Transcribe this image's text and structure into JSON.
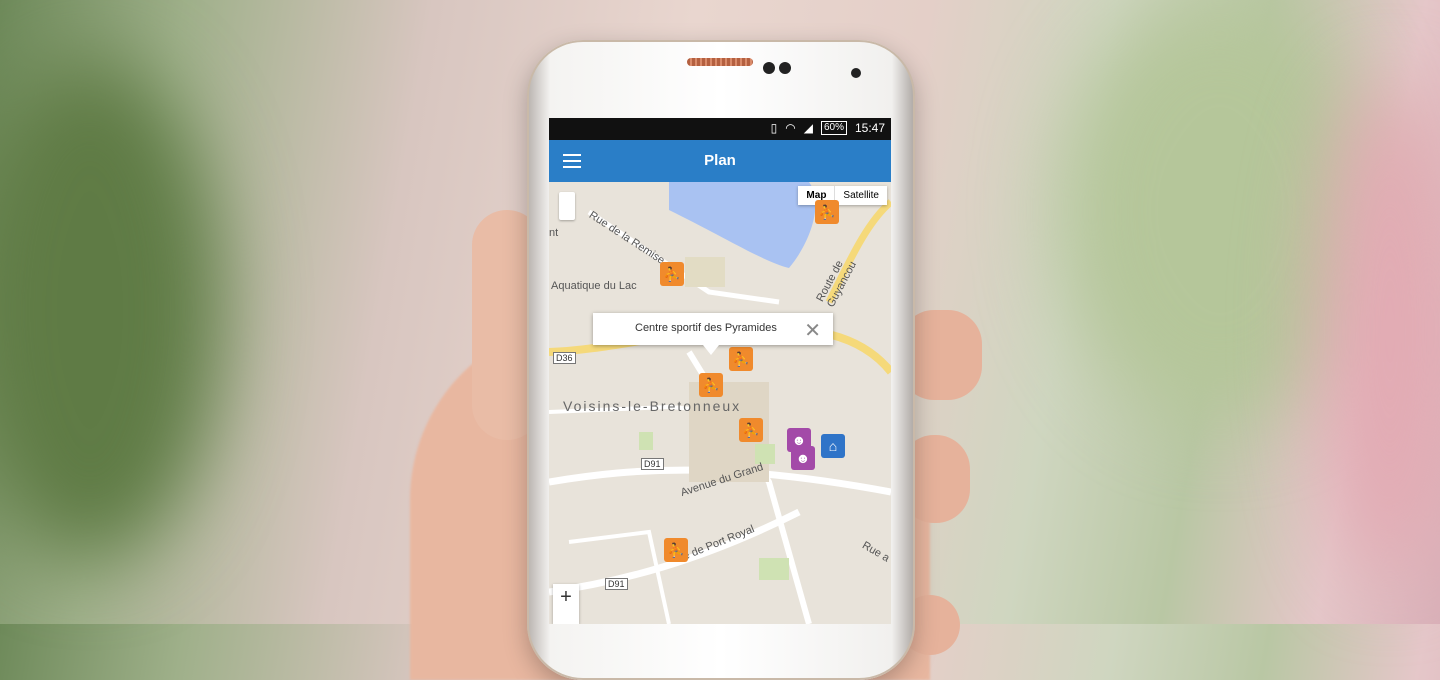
{
  "status_bar": {
    "battery": "60%",
    "time": "15:47"
  },
  "app_bar": {
    "title": "Plan"
  },
  "map_type": {
    "map": "Map",
    "satellite": "Satellite"
  },
  "popup": {
    "title": "Centre sportif des Pyramides"
  },
  "map_labels": {
    "town": "Voisins-le-Bretonneux",
    "rue_remise": "Rue de la Remise",
    "aquatique": "Aquatique du Lac",
    "route_guyancourt": "Route de Guyancou",
    "avenue_grand": "Avenue du Grand",
    "rue_port_royal": "ue de Port Royal",
    "rue_a": "Rue a",
    "nt": "nt"
  },
  "road_tags": {
    "d36": "D36",
    "d91a": "D91",
    "d91b": "D91"
  },
  "zoom": {
    "plus": "+",
    "minus": "−"
  },
  "icons": {
    "sport": "sport-pin-icon",
    "theatre": "theatre-pin-icon",
    "school": "school-pin-icon"
  },
  "colors": {
    "app_bar": "#2a7ec7",
    "sport_pin": "#f08a2c",
    "theatre_pin": "#a34aa8",
    "school_pin": "#2f74c8"
  }
}
